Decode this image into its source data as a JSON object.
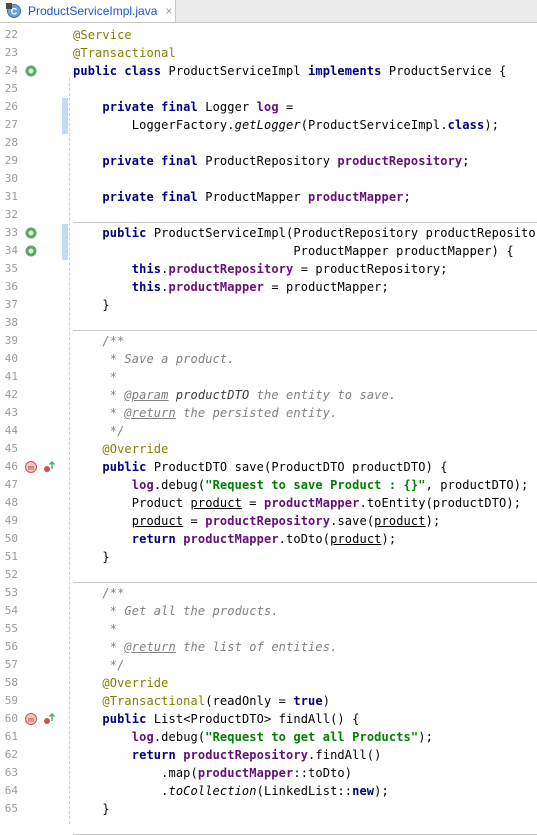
{
  "tab": {
    "filename": "ProductServiceImpl.java",
    "icon": "java-class-icon",
    "close_label": "×"
  },
  "colors": {
    "keyword": "#000080",
    "annotation": "#808000",
    "field": "#660e7a",
    "string": "#008000",
    "comment": "#808080"
  },
  "lines": [
    {
      "n": "22",
      "tokens": [
        {
          "t": "@Service",
          "c": "ann"
        }
      ]
    },
    {
      "n": "23",
      "tokens": [
        {
          "t": "@Transactional",
          "c": "ann"
        }
      ]
    },
    {
      "n": "24",
      "gutter": [
        "implemented-green-icon"
      ],
      "tokens": [
        {
          "t": "public class ",
          "c": "kw"
        },
        {
          "t": "ProductServiceImpl "
        },
        {
          "t": "implements ",
          "c": "kw"
        },
        {
          "t": "ProductService {"
        }
      ]
    },
    {
      "n": "25",
      "tokens": []
    },
    {
      "n": "26",
      "tokens": [
        {
          "t": "    "
        },
        {
          "t": "private final ",
          "c": "kw"
        },
        {
          "t": "Logger "
        },
        {
          "t": "log",
          "c": "fld"
        },
        {
          "t": " ="
        }
      ]
    },
    {
      "n": "27",
      "tokens": [
        {
          "t": "        LoggerFactory."
        },
        {
          "t": "getLogger",
          "c": "it"
        },
        {
          "t": "(ProductServiceImpl."
        },
        {
          "t": "class",
          "c": "kw"
        },
        {
          "t": ");"
        }
      ]
    },
    {
      "n": "28",
      "tokens": []
    },
    {
      "n": "29",
      "tokens": [
        {
          "t": "    "
        },
        {
          "t": "private final ",
          "c": "kw"
        },
        {
          "t": "ProductRepository "
        },
        {
          "t": "productRepository",
          "c": "fld"
        },
        {
          "t": ";"
        }
      ]
    },
    {
      "n": "30",
      "tokens": []
    },
    {
      "n": "31",
      "tokens": [
        {
          "t": "    "
        },
        {
          "t": "private final ",
          "c": "kw"
        },
        {
          "t": "ProductMapper "
        },
        {
          "t": "productMapper",
          "c": "fld"
        },
        {
          "t": ";"
        }
      ]
    },
    {
      "n": "32",
      "tokens": []
    },
    {
      "n": "33",
      "gutter": [
        "bean-green-icon"
      ],
      "tokens": [
        {
          "t": "    "
        },
        {
          "t": "public ",
          "c": "kw"
        },
        {
          "t": "ProductServiceImpl(ProductRepository productRepository,"
        }
      ]
    },
    {
      "n": "34",
      "gutter": [
        "bean-green-icon"
      ],
      "tokens": [
        {
          "t": "                              ProductMapper productMapper) {"
        }
      ]
    },
    {
      "n": "35",
      "tokens": [
        {
          "t": "        "
        },
        {
          "t": "this",
          "c": "kw"
        },
        {
          "t": "."
        },
        {
          "t": "productRepository",
          "c": "fld"
        },
        {
          "t": " = productRepository;"
        }
      ]
    },
    {
      "n": "36",
      "tokens": [
        {
          "t": "        "
        },
        {
          "t": "this",
          "c": "kw"
        },
        {
          "t": "."
        },
        {
          "t": "productMapper",
          "c": "fld"
        },
        {
          "t": " = productMapper;"
        }
      ]
    },
    {
      "n": "37",
      "tokens": [
        {
          "t": "    }"
        }
      ]
    },
    {
      "n": "38",
      "tokens": []
    },
    {
      "n": "39",
      "tokens": [
        {
          "t": "    /**",
          "c": "com"
        }
      ]
    },
    {
      "n": "40",
      "tokens": [
        {
          "t": "     * Save a product.",
          "c": "com"
        }
      ]
    },
    {
      "n": "41",
      "tokens": [
        {
          "t": "     *",
          "c": "com"
        }
      ]
    },
    {
      "n": "42",
      "tokens": [
        {
          "t": "     * ",
          "c": "com"
        },
        {
          "t": "@param",
          "c": "dtag"
        },
        {
          "t": " "
        },
        {
          "t": "productDTO",
          "c": "dparam"
        },
        {
          "t": " the entity to save.",
          "c": "com"
        }
      ]
    },
    {
      "n": "43",
      "tokens": [
        {
          "t": "     * ",
          "c": "com"
        },
        {
          "t": "@return",
          "c": "dtag"
        },
        {
          "t": " the persisted entity.",
          "c": "com"
        }
      ]
    },
    {
      "n": "44",
      "tokens": [
        {
          "t": "     */",
          "c": "com"
        }
      ]
    },
    {
      "n": "45",
      "tokens": [
        {
          "t": "    "
        },
        {
          "t": "@Override",
          "c": "ann"
        }
      ]
    },
    {
      "n": "46",
      "gutter": [
        "transactional-method-icon",
        "overrides-icon"
      ],
      "tokens": [
        {
          "t": "    "
        },
        {
          "t": "public ",
          "c": "kw"
        },
        {
          "t": "ProductDTO save(ProductDTO productDTO) {"
        }
      ]
    },
    {
      "n": "47",
      "tokens": [
        {
          "t": "        "
        },
        {
          "t": "log",
          "c": "fld"
        },
        {
          "t": ".debug("
        },
        {
          "t": "\"Request to save Product : {}\"",
          "c": "str"
        },
        {
          "t": ", productDTO);"
        }
      ]
    },
    {
      "n": "48",
      "tokens": [
        {
          "t": "        Product "
        },
        {
          "t": "product",
          "c": "ul"
        },
        {
          "t": " = "
        },
        {
          "t": "productMapper",
          "c": "fld"
        },
        {
          "t": ".toEntity(productDTO);"
        }
      ]
    },
    {
      "n": "49",
      "tokens": [
        {
          "t": "        "
        },
        {
          "t": "product",
          "c": "ul"
        },
        {
          "t": " = "
        },
        {
          "t": "productRepository",
          "c": "fld"
        },
        {
          "t": ".save("
        },
        {
          "t": "product",
          "c": "ul"
        },
        {
          "t": ");"
        }
      ]
    },
    {
      "n": "50",
      "tokens": [
        {
          "t": "        "
        },
        {
          "t": "return ",
          "c": "kw"
        },
        {
          "t": "productMapper",
          "c": "fld"
        },
        {
          "t": ".toDto("
        },
        {
          "t": "product",
          "c": "ul"
        },
        {
          "t": ");"
        }
      ]
    },
    {
      "n": "51",
      "tokens": [
        {
          "t": "    }"
        }
      ]
    },
    {
      "n": "52",
      "tokens": []
    },
    {
      "n": "53",
      "tokens": [
        {
          "t": "    /**",
          "c": "com"
        }
      ]
    },
    {
      "n": "54",
      "tokens": [
        {
          "t": "     * Get all the products.",
          "c": "com"
        }
      ]
    },
    {
      "n": "55",
      "tokens": [
        {
          "t": "     *",
          "c": "com"
        }
      ]
    },
    {
      "n": "56",
      "tokens": [
        {
          "t": "     * ",
          "c": "com"
        },
        {
          "t": "@return",
          "c": "dtag"
        },
        {
          "t": " the list of entities.",
          "c": "com"
        }
      ]
    },
    {
      "n": "57",
      "tokens": [
        {
          "t": "     */",
          "c": "com"
        }
      ]
    },
    {
      "n": "58",
      "tokens": [
        {
          "t": "    "
        },
        {
          "t": "@Override",
          "c": "ann"
        }
      ]
    },
    {
      "n": "59",
      "tokens": [
        {
          "t": "    "
        },
        {
          "t": "@Transactional",
          "c": "ann"
        },
        {
          "t": "(readOnly = "
        },
        {
          "t": "true",
          "c": "kw"
        },
        {
          "t": ")"
        }
      ]
    },
    {
      "n": "60",
      "gutter": [
        "transactional-method-icon",
        "overrides-icon"
      ],
      "tokens": [
        {
          "t": "    "
        },
        {
          "t": "public ",
          "c": "kw"
        },
        {
          "t": "List<ProductDTO> findAll() {"
        }
      ]
    },
    {
      "n": "61",
      "tokens": [
        {
          "t": "        "
        },
        {
          "t": "log",
          "c": "fld"
        },
        {
          "t": ".debug("
        },
        {
          "t": "\"Request to get all Products\"",
          "c": "str"
        },
        {
          "t": ");"
        }
      ]
    },
    {
      "n": "62",
      "tokens": [
        {
          "t": "        "
        },
        {
          "t": "return ",
          "c": "kw"
        },
        {
          "t": "productRepository",
          "c": "fld"
        },
        {
          "t": ".findAll()"
        }
      ]
    },
    {
      "n": "63",
      "tokens": [
        {
          "t": "            .map("
        },
        {
          "t": "productMapper",
          "c": "fld"
        },
        {
          "t": "::toDto)"
        }
      ]
    },
    {
      "n": "64",
      "tokens": [
        {
          "t": "            ."
        },
        {
          "t": "toCollection",
          "c": "it"
        },
        {
          "t": "(LinkedList::"
        },
        {
          "t": "new",
          "c": "kw"
        },
        {
          "t": ");"
        }
      ]
    },
    {
      "n": "65",
      "tokens": [
        {
          "t": "    }"
        }
      ]
    }
  ]
}
